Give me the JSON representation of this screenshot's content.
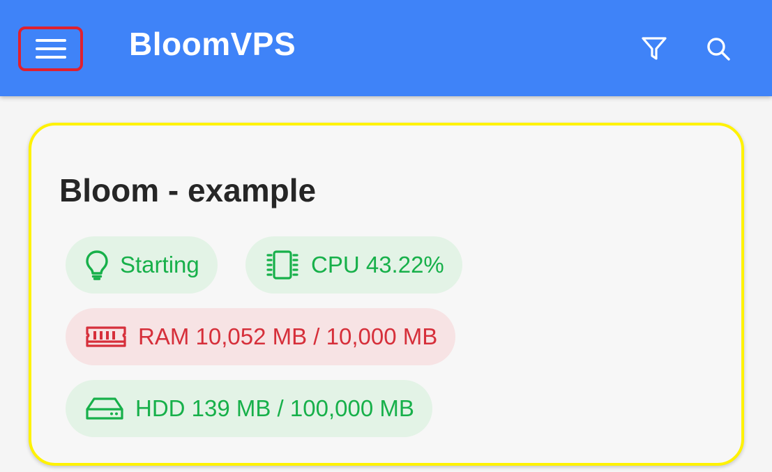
{
  "appbar": {
    "title": "BloomVPS",
    "background": "#3f83f8",
    "menu_icon": "hamburger-menu-icon",
    "filter_icon": "filter-icon",
    "search_icon": "search-icon"
  },
  "server_card": {
    "name": "Bloom - example",
    "chips": {
      "status": {
        "icon": "lightbulb-icon",
        "label": "Starting",
        "color": "#17b04a"
      },
      "cpu": {
        "icon": "cpu-chip-icon",
        "label": "CPU 43.22%",
        "color": "#17b04a"
      },
      "ram": {
        "icon": "memory-icon",
        "label": "RAM 10,052 MB / 10,000 MB",
        "color": "#d62f3a"
      },
      "hdd": {
        "icon": "hard-drive-icon",
        "label": "HDD 139 MB / 100,000 MB",
        "color": "#17b04a"
      }
    }
  }
}
